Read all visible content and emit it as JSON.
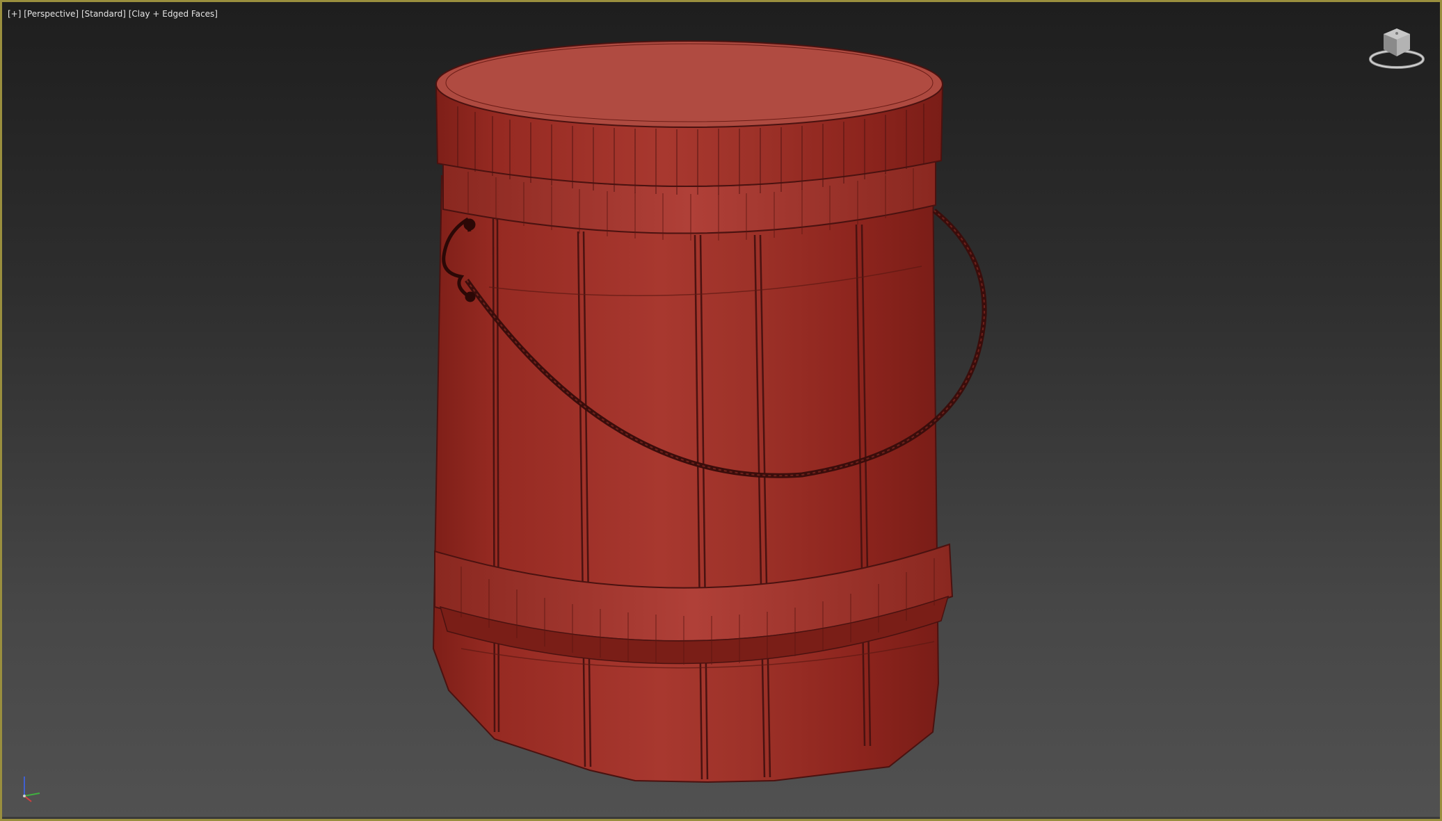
{
  "viewport": {
    "labels": {
      "menu": "[+]",
      "view": "[Perspective]",
      "shading": "[Standard]",
      "display_mode": "[Clay + Edged Faces]"
    },
    "active_border_color": "#9a8f3e"
  },
  "scene": {
    "object": "wooden-bucket",
    "base_color": "#a8382f",
    "edge_color": "#4a1210",
    "handle_color": "#3a0d0b"
  },
  "icons": {
    "viewcube": "viewcube-icon",
    "axis_tripod": "axis-tripod-icon"
  }
}
